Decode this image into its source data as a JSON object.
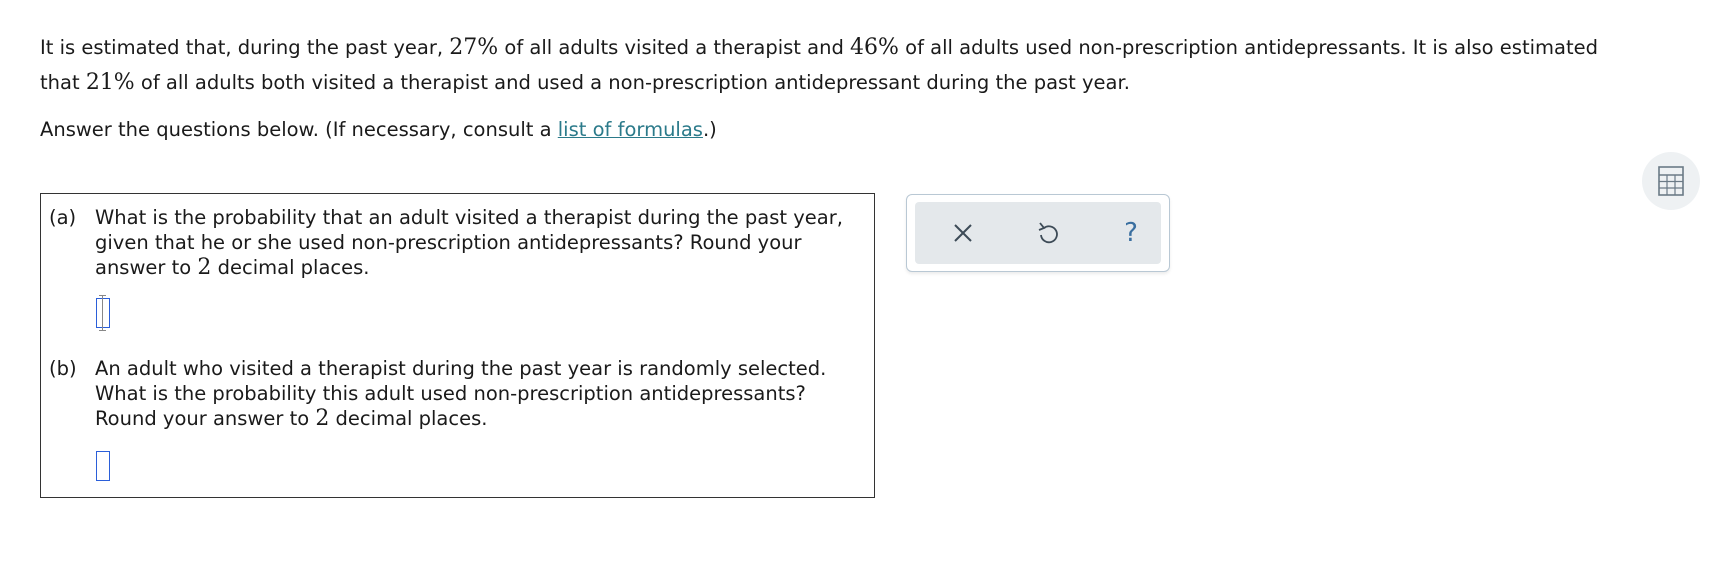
{
  "intro": {
    "s1_pre": "It is estimated that, during the past year, ",
    "s1_pct1": "27%",
    "s1_mid": " of all adults visited a therapist and ",
    "s1_pct2": "46%",
    "s1_post": " of all adults used non-prescription antidepressants. It is also estimated",
    "s2_pre": "that ",
    "s2_pct": "21%",
    "s2_post": " of all adults both visited a therapist and used a non-prescription antidepressant during the past year."
  },
  "answer_instructions": {
    "pre": "Answer the questions below. (If necessary, consult a ",
    "link": "list of formulas",
    "post": ".)"
  },
  "parts": [
    {
      "label": "(a)",
      "text_pre": "What is the probability that an adult visited a therapist during the past year, given that he or she used non-prescription antidepressants? Round your answer to ",
      "decimals": "2",
      "text_post": " decimal places.",
      "answer_value": ""
    },
    {
      "label": "(b)",
      "text_pre": "An adult who visited a therapist during the past year is randomly selected. What is the probability this adult used non-prescription antidepressants? Round your answer to ",
      "decimals": "2",
      "text_post": " decimal places.",
      "answer_value": ""
    }
  ],
  "toolbar": {
    "clear_icon": "x-icon",
    "undo_icon": "undo-icon",
    "help_icon": "help-icon",
    "help_glyph": "?",
    "accent_color": "#3a6fa0"
  },
  "calculator": {
    "icon": "calculator-icon"
  }
}
